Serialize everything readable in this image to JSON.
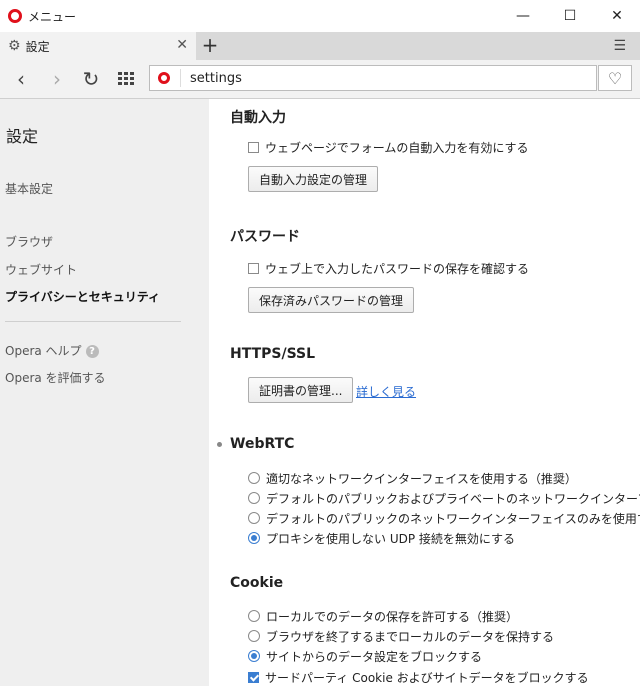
{
  "titlebar": {
    "menu_label": "メニュー",
    "minimize": "—",
    "maximize": "☐",
    "close": "✕"
  },
  "tab": {
    "icon": "gear-icon",
    "title": "設定",
    "close": "✕",
    "new_tab": "+",
    "tab_menu": "☰"
  },
  "toolbar": {
    "back": "‹",
    "forward": "›",
    "reload": "↻",
    "address": "settings",
    "bookmark": "♡"
  },
  "sidebar": {
    "title": "設定",
    "items": [
      {
        "label": "基本設定",
        "active": false
      },
      {
        "label": "ブラウザ",
        "active": false
      },
      {
        "label": "ウェブサイト",
        "active": false
      },
      {
        "label": "プライバシーとセキュリティ",
        "active": true
      }
    ],
    "help": {
      "label": "Opera ヘルプ",
      "icon_glyph": "?"
    },
    "rate": {
      "label": "Opera を評価する"
    }
  },
  "main": {
    "autofill": {
      "title": "自動入力",
      "checkbox": {
        "label": "ウェブページでフォームの自動入力を有効にする",
        "checked": false
      },
      "button": "自動入力設定の管理"
    },
    "password": {
      "title": "パスワード",
      "checkbox": {
        "label": "ウェブ上で入力したパスワードの保存を確認する",
        "checked": false
      },
      "button": "保存済みパスワードの管理"
    },
    "https": {
      "title": "HTTPS/SSL",
      "button": "証明書の管理...",
      "link": "詳しく見る"
    },
    "webrtc": {
      "title": "WebRTC",
      "options": [
        {
          "label": "適切なネットワークインターフェイスを使用する（推奨）",
          "checked": false
        },
        {
          "label": "デフォルトのパブリックおよびプライベートのネットワークインターフェイスのみを使用する",
          "checked": false
        },
        {
          "label": "デフォルトのパブリックのネットワークインターフェイスのみを使用する",
          "checked": false
        },
        {
          "label": "プロキシを使用しない UDP 接続を無効にする",
          "checked": true
        }
      ]
    },
    "cookie": {
      "title": "Cookie",
      "options": [
        {
          "label": "ローカルでのデータの保存を許可する（推奨）",
          "checked": false
        },
        {
          "label": "ブラウザを終了するまでローカルのデータを保持する",
          "checked": false
        },
        {
          "label": "サイトからのデータ設定をブロックする",
          "checked": true
        }
      ],
      "third_party": {
        "label": "サードパーティ Cookie およびサイトデータをブロックする",
        "checked": true
      }
    }
  },
  "colors": {
    "accent": "#3b7ed1",
    "opera_red": "#e0101b",
    "link": "#2a6bd1"
  }
}
